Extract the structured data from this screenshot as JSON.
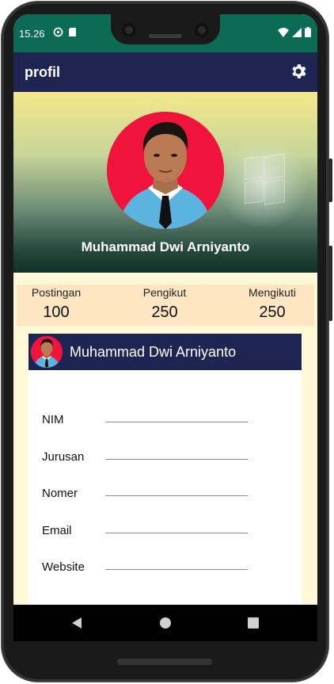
{
  "status_bar": {
    "time": "15.26",
    "icons_left": [
      "sync-icon",
      "sd-card-icon"
    ],
    "icons_right": [
      "wifi-icon",
      "signal-icon",
      "battery-icon"
    ],
    "color": "#0b6b55"
  },
  "app_bar": {
    "title": "profil",
    "settings_icon": "gear-icon",
    "color": "#1f2552"
  },
  "profile": {
    "name": "Muhammad Dwi Arniyanto",
    "avatar_bg": "#f0143c"
  },
  "stats": [
    {
      "label": "Postingan",
      "value": "100"
    },
    {
      "label": "Pengikut",
      "value": "250"
    },
    {
      "label": "Mengikuti",
      "value": "250"
    }
  ],
  "card": {
    "name": "Muhammad Dwi Arniyanto",
    "fields": [
      {
        "label": "NIM",
        "value": ""
      },
      {
        "label": "Jurusan",
        "value": ""
      },
      {
        "label": "Nomer",
        "value": ""
      },
      {
        "label": "Email",
        "value": ""
      },
      {
        "label": "Website",
        "value": ""
      }
    ]
  },
  "nav_bar": {
    "buttons": [
      "back-icon",
      "home-icon",
      "recents-icon"
    ]
  }
}
